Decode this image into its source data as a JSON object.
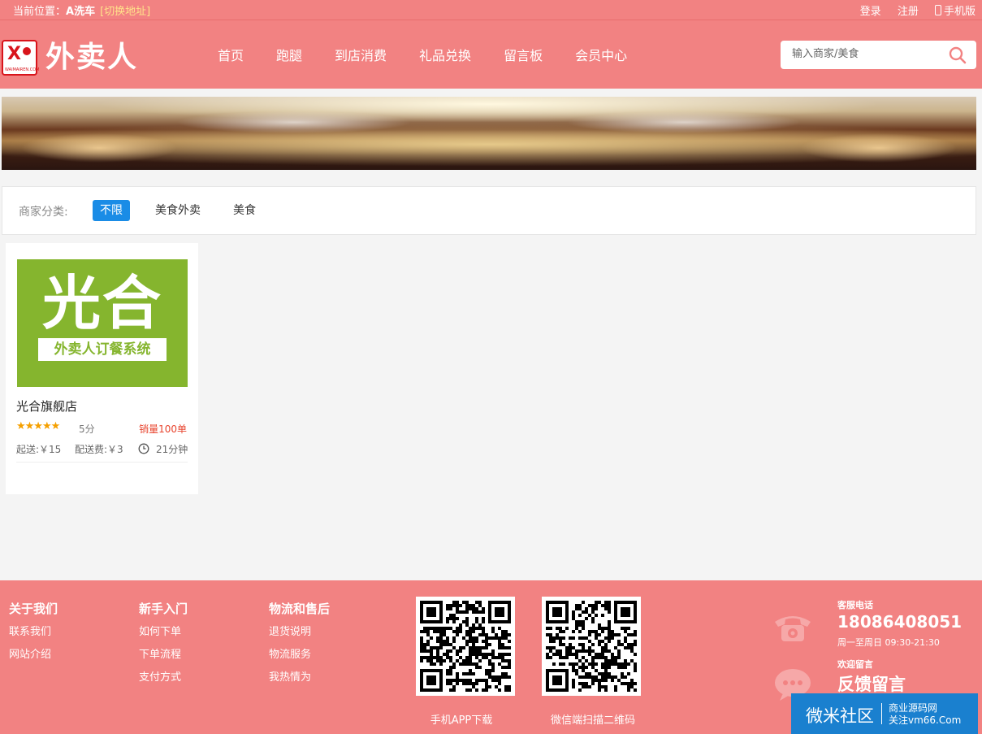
{
  "topbar": {
    "location_prefix": "当前位置：",
    "location": "A洗车",
    "switch_label": "[切换地址]",
    "login": "登录",
    "register": "注册",
    "mobile": "手机版"
  },
  "header": {
    "logo_text": "外卖人",
    "nav": [
      "首页",
      "跑腿",
      "到店消费",
      "礼品兑换",
      "留言板",
      "会员中心"
    ],
    "search_placeholder": "输入商家/美食"
  },
  "filter": {
    "label": "商家分类:",
    "options": [
      "不限",
      "美食外卖",
      "美食"
    ],
    "selected": "不限"
  },
  "shops": [
    {
      "image_title": "光合",
      "image_subtitle": "外卖人订餐系统",
      "name": "光合旗舰店",
      "rating_stars": 5,
      "score": "5分",
      "sales": "销量100单",
      "min_order": "起送:￥15",
      "delivery_fee": "配送费:￥3",
      "delivery_time": "21分钟"
    }
  ],
  "footer": {
    "columns": [
      {
        "title": "关于我们",
        "items": [
          "联系我们",
          "网站介绍"
        ]
      },
      {
        "title": "新手入门",
        "items": [
          "如何下单",
          "下单流程",
          "支付方式"
        ]
      },
      {
        "title": "物流和售后",
        "items": [
          "退货说明",
          "物流服务",
          "我热情为"
        ]
      }
    ],
    "qr_captions": [
      "手机APP下载",
      "微信端扫描二维码"
    ],
    "service_label": "客服电话",
    "service_phone": "18086408051",
    "service_hours": "周一至周日 09:30-21:30",
    "feedback_label": "欢迎留言",
    "feedback_link": "反馈留言"
  },
  "watermark": {
    "brand": "微米社区",
    "line1": "商业源码网",
    "line2": "关注vm66.Com"
  },
  "colors": {
    "theme": "#f28282",
    "active_filter": "#1a8ce6",
    "shop_image_bg": "#85b52e",
    "sales": "#e8442e",
    "stars": "#f5a000"
  }
}
